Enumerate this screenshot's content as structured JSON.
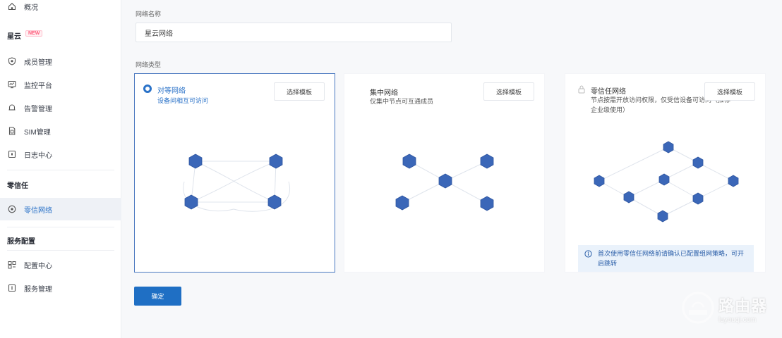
{
  "sidebar": {
    "top_item": {
      "label": "概况",
      "icon": "home-icon"
    },
    "groups": [
      {
        "title": "星云",
        "badge": "NEW"
      },
      {
        "title": "零信任"
      },
      {
        "title": "服务配置"
      }
    ],
    "items": [
      {
        "label": "成员管理",
        "icon": "shield-icon"
      },
      {
        "label": "监控平台",
        "icon": "monitor-icon"
      },
      {
        "label": "告警管理",
        "icon": "bell-icon"
      },
      {
        "label": "SIM管理",
        "icon": "sim-icon"
      },
      {
        "label": "日志中心",
        "icon": "log-icon"
      },
      {
        "label": "零信网络",
        "icon": "network-icon"
      },
      {
        "label": "配置中心",
        "icon": "config-icon"
      },
      {
        "label": "服务管理",
        "icon": "service-icon"
      }
    ]
  },
  "form": {
    "name_label": "网络名称",
    "name_value": "星云网络",
    "type_label": "网络类型"
  },
  "cards": [
    {
      "title": "对等网络",
      "desc": "设备间相互可访问",
      "template_button": "选择模板",
      "selected": true
    },
    {
      "title": "集中网络",
      "desc": "仅集中节点可互通成员",
      "template_button": "选择模板",
      "selected": false
    },
    {
      "title": "零信任网络",
      "desc": "节点按需开放访问权限，仅受信设备可访问（推荐企业级使用）",
      "template_button": "选择模板",
      "selected": false,
      "notice": "首次使用零信任网络前请确认已配置组网策略，可开启跳转"
    }
  ],
  "confirm_button": "确定",
  "watermark": {
    "title": "路由器",
    "subtitle": "luyouqi.com"
  },
  "colors": {
    "accent": "#1f6fc4",
    "node": "#3b67b8",
    "node_dark": "#2f56a0"
  }
}
